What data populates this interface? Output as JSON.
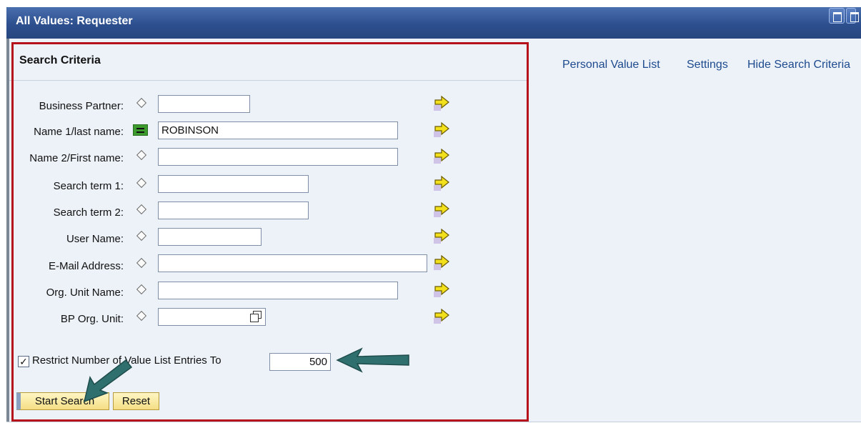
{
  "window": {
    "title": "All Values: Requester"
  },
  "search_criteria": {
    "title": "Search Criteria"
  },
  "top_links": [
    "Personal Value List",
    "Settings",
    "Hide Search Criteria"
  ],
  "fields": [
    {
      "label": "Business Partner:",
      "value": "",
      "operator": "diamond"
    },
    {
      "label": "Name 1/last name:",
      "value": "ROBINSON",
      "operator": "equals"
    },
    {
      "label": "Name 2/First name:",
      "value": "",
      "operator": "diamond"
    },
    {
      "label": "Search term 1:",
      "value": "",
      "operator": "diamond"
    },
    {
      "label": "Search term 2:",
      "value": "",
      "operator": "diamond"
    },
    {
      "label": "User Name:",
      "value": "",
      "operator": "diamond"
    },
    {
      "label": "E-Mail Address:",
      "value": "",
      "operator": "diamond"
    },
    {
      "label": "Org. Unit Name:",
      "value": "",
      "operator": "diamond"
    },
    {
      "label": "BP Org. Unit:",
      "value": "",
      "operator": "diamond"
    }
  ],
  "restrict": {
    "checked": true,
    "check_glyph": "✓",
    "label": "Restrict Number of Value List Entries To",
    "value": "500"
  },
  "buttons": {
    "start_search": "Start Search",
    "reset": "Reset"
  },
  "colors": {
    "title_bar": "#2d4f8e",
    "highlight_box": "#b5121b",
    "annotation_arrow": "#2f6f6e",
    "button": "#f4de84"
  },
  "icons": {
    "operator_default": "diamond-icon",
    "operator_equals": "equals-icon",
    "more_criteria": "yellow-arrow-icon",
    "value_help": "value-help-icon"
  }
}
